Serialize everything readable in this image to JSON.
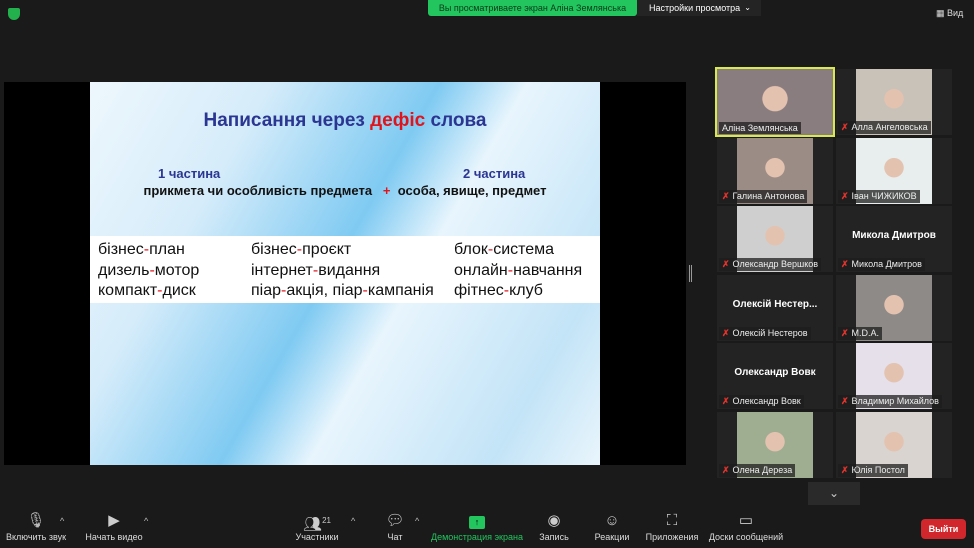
{
  "top": {
    "banner": "Вы просматриваете экран Аліна Землянська",
    "view_settings": "Настройки просмотра",
    "view": "Вид",
    "shield_color": "#23b14d"
  },
  "slide": {
    "title_a": "Написання через ",
    "title_b": "дефіс",
    "title_c": " слова",
    "part1": "1 частина",
    "part2": "2 частина",
    "desc_a": "прикмета чи особливість предмета",
    "plus": "+",
    "desc_b": "особа, явище,  предмет",
    "columns": [
      [
        "бізнес-план",
        "дизель-мотор",
        "компакт-диск"
      ],
      [
        "бізнес-проєкт",
        "інтернет-видання",
        "піар-акція, піар-кампанія"
      ],
      [
        "блок-система",
        "онлайн-навчання",
        "фітнес-клуб"
      ]
    ]
  },
  "participants": [
    {
      "name": "Аліна Землянська",
      "muted": false,
      "video": true,
      "active": true,
      "color": "#8a7d80"
    },
    {
      "name": "Алла Ангеловська",
      "muted": true,
      "video": true,
      "color": "#c9c2b8"
    },
    {
      "name": "Галина Антонова",
      "muted": true,
      "video": true,
      "color": "#9c8c86"
    },
    {
      "name": "Іван ЧИЖИКОВ",
      "muted": true,
      "video": true,
      "color": "#e8eeee"
    },
    {
      "name": "Олександр Вершков",
      "muted": true,
      "video": true,
      "color": "#cfcfcf"
    },
    {
      "name": "Микола Дмитров",
      "muted": true,
      "video": false,
      "big": "Микола Дмитров"
    },
    {
      "name": "Олексій Нестеров",
      "muted": true,
      "video": false,
      "big": "Олексій  Нестер..."
    },
    {
      "name": "M.D.A.",
      "muted": true,
      "video": true,
      "color": "#8d8a88"
    },
    {
      "name": "Олександр Вовк",
      "muted": true,
      "video": false,
      "big": "Олександр Вовк"
    },
    {
      "name": "Владимир Михайлов",
      "muted": true,
      "video": true,
      "color": "#e5e0ea"
    },
    {
      "name": "Олена Дереза",
      "muted": true,
      "video": true,
      "color": "#9fae90"
    },
    {
      "name": "Юлія Постол",
      "muted": true,
      "video": true,
      "color": "#d9d4d0"
    }
  ],
  "toolbar": {
    "unmute": "Включить звук",
    "start_video": "Начать видео",
    "participants": "Участники",
    "participants_count": "21",
    "chat": "Чат",
    "share": "Демонстрация экрана",
    "record": "Запись",
    "reactions": "Реакции",
    "apps": "Приложения",
    "whiteboards": "Доски сообщений",
    "leave": "Выйти",
    "share_color": "#22c55e",
    "leave_color": "#d1262b"
  }
}
